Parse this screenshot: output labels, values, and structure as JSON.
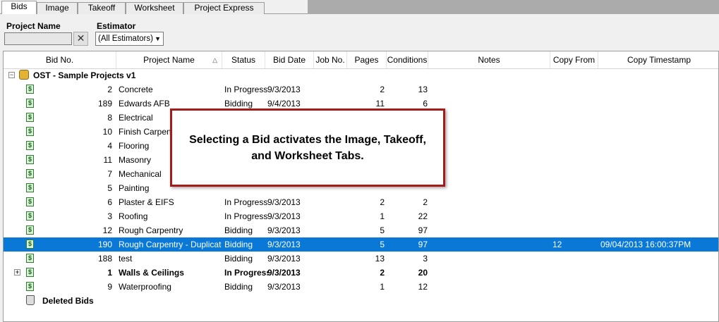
{
  "tabs": [
    {
      "label": "Bids",
      "active": true
    },
    {
      "label": "Image",
      "active": false
    },
    {
      "label": "Takeoff",
      "active": false
    },
    {
      "label": "Worksheet",
      "active": false
    },
    {
      "label": "Project Express",
      "active": false
    }
  ],
  "filters": {
    "project_name_label": "Project Name",
    "project_name_value": "",
    "clear_glyph": "✕",
    "estimator_label": "Estimator",
    "estimator_selected": "(All Estimators)"
  },
  "columns": [
    {
      "label": "Bid No."
    },
    {
      "label": "Project Name",
      "sorted": "ascending"
    },
    {
      "label": "Status"
    },
    {
      "label": "Bid Date"
    },
    {
      "label": "Job No."
    },
    {
      "label": "Pages"
    },
    {
      "label": "Conditions"
    },
    {
      "label": "Notes"
    },
    {
      "label": "Copy From"
    },
    {
      "label": "Copy Timestamp"
    }
  ],
  "group": {
    "label": "OST - Sample Projects v1",
    "expanded": true,
    "icon": "database-folder-icon"
  },
  "rows": [
    {
      "bid_no": "2",
      "project_name": "Concrete",
      "status": "In Progress",
      "bid_date": "9/3/2013",
      "job_no": "",
      "pages": "2",
      "conditions": "13",
      "notes": "",
      "copy_from": "",
      "copy_timestamp": ""
    },
    {
      "bid_no": "189",
      "project_name": "Edwards AFB",
      "status": "Bidding",
      "bid_date": "9/4/2013",
      "job_no": "",
      "pages": "11",
      "conditions": "6",
      "notes": "",
      "copy_from": "",
      "copy_timestamp": ""
    },
    {
      "bid_no": "8",
      "project_name": "Electrical",
      "status": "",
      "bid_date": "",
      "job_no": "",
      "pages": "",
      "conditions": "",
      "notes": "",
      "copy_from": "",
      "copy_timestamp": ""
    },
    {
      "bid_no": "10",
      "project_name": "Finish Carpentry",
      "status": "",
      "bid_date": "",
      "job_no": "",
      "pages": "",
      "conditions": "",
      "notes": "",
      "copy_from": "",
      "copy_timestamp": ""
    },
    {
      "bid_no": "4",
      "project_name": "Flooring",
      "status": "",
      "bid_date": "",
      "job_no": "",
      "pages": "",
      "conditions": "",
      "notes": "",
      "copy_from": "",
      "copy_timestamp": ""
    },
    {
      "bid_no": "11",
      "project_name": "Masonry",
      "status": "",
      "bid_date": "",
      "job_no": "",
      "pages": "",
      "conditions": "",
      "notes": "",
      "copy_from": "",
      "copy_timestamp": ""
    },
    {
      "bid_no": "7",
      "project_name": "Mechanical",
      "status": "",
      "bid_date": "",
      "job_no": "",
      "pages": "",
      "conditions": "",
      "notes": "",
      "copy_from": "",
      "copy_timestamp": ""
    },
    {
      "bid_no": "5",
      "project_name": "Painting",
      "status": "",
      "bid_date": "",
      "job_no": "",
      "pages": "",
      "conditions": "",
      "notes": "",
      "copy_from": "",
      "copy_timestamp": ""
    },
    {
      "bid_no": "6",
      "project_name": "Plaster & EIFS",
      "status": "In Progress",
      "bid_date": "9/3/2013",
      "job_no": "",
      "pages": "2",
      "conditions": "2",
      "notes": "",
      "copy_from": "",
      "copy_timestamp": ""
    },
    {
      "bid_no": "3",
      "project_name": "Roofing",
      "status": "In Progress",
      "bid_date": "9/3/2013",
      "job_no": "",
      "pages": "1",
      "conditions": "22",
      "notes": "",
      "copy_from": "",
      "copy_timestamp": ""
    },
    {
      "bid_no": "12",
      "project_name": "Rough Carpentry",
      "status": "Bidding",
      "bid_date": "9/3/2013",
      "job_no": "",
      "pages": "5",
      "conditions": "97",
      "notes": "",
      "copy_from": "",
      "copy_timestamp": ""
    },
    {
      "bid_no": "190",
      "project_name": "Rough Carpentry - Duplicate",
      "status": "Bidding",
      "bid_date": "9/3/2013",
      "job_no": "",
      "pages": "5",
      "conditions": "97",
      "notes": "",
      "copy_from": "12",
      "copy_timestamp": "09/04/2013 16:00:37PM",
      "selected": true
    },
    {
      "bid_no": "188",
      "project_name": "test",
      "status": "Bidding",
      "bid_date": "9/3/2013",
      "job_no": "",
      "pages": "13",
      "conditions": "3",
      "notes": "",
      "copy_from": "",
      "copy_timestamp": ""
    },
    {
      "bid_no": "1",
      "project_name": "Walls & Ceilings",
      "status": "In Progress",
      "bid_date": "9/3/2013",
      "job_no": "",
      "pages": "2",
      "conditions": "20",
      "notes": "",
      "copy_from": "",
      "copy_timestamp": "",
      "bold": true,
      "expandable": true
    },
    {
      "bid_no": "9",
      "project_name": "Waterproofing",
      "status": "Bidding",
      "bid_date": "9/3/2013",
      "job_no": "",
      "pages": "1",
      "conditions": "12",
      "notes": "",
      "copy_from": "",
      "copy_timestamp": ""
    }
  ],
  "deleted_group": {
    "label": "Deleted Bids",
    "icon": "trash-icon"
  },
  "callout": {
    "text": "Selecting a Bid activates the Image, Takeoff, and Worksheet Tabs."
  },
  "colors": {
    "selection": "#0a78d7",
    "callout_border": "#a31c1c"
  }
}
